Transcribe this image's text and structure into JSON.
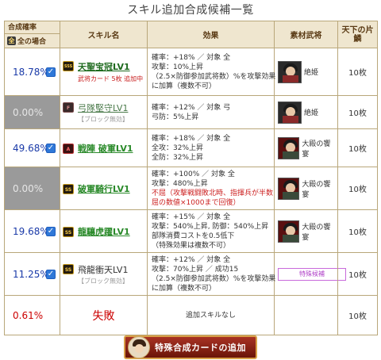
{
  "page_title": "スキル追加合成候補一覧",
  "headers": {
    "rate": "合成確率",
    "all_case": "全の場合",
    "all_icon": "全",
    "skill": "スキル名",
    "effect": "効果",
    "material": "素材武将",
    "tenka": "天下の片鱗"
  },
  "rows": [
    {
      "rate": "18.78%",
      "checked": true,
      "rank": "SSS",
      "skill_name": "天聖宝冠LV1",
      "sub": "武将カード 5枚 追加中",
      "effect_lines": [
        "確率：+18% ／ 対象 全",
        "攻撃：10%上昇",
        "（2.5×防御参加武将数）%を攻撃効果",
        "に加算（複数不可）"
      ],
      "material_name": "絶姫",
      "tenka": "10枚"
    },
    {
      "rate": "0.00%",
      "checked": false,
      "rank": "F",
      "skill_name": "弓隊堅守LV1",
      "blocked": "【ブロック無効】",
      "effect_lines": [
        "確率：+12% ／ 対象 弓",
        "弓防：5%上昇"
      ],
      "material_name": "絶姫",
      "tenka": "10枚"
    },
    {
      "rate": "49.68%",
      "checked": true,
      "rank": "A",
      "skill_name": "戦陣 破軍LV1",
      "effect_lines": [
        "確率：+18% ／ 対象 全",
        "全攻：32%上昇",
        "全防：32%上昇"
      ],
      "material_name": "大殿の饗宴",
      "tenka": "10枚"
    },
    {
      "rate": "0.00%",
      "checked": false,
      "rank": "SS",
      "skill_name": "破軍騎行LV1",
      "effect_lines": [
        "確率：+100% ／ 対象 全",
        "攻撃：480%上昇",
        "不屈（攻撃戦闘敗北時、指揮兵が半数",
        "屈の数値×1000まで回復）"
      ],
      "material_name": "大殿の饗宴",
      "tenka": "10枚"
    },
    {
      "rate": "19.68%",
      "checked": true,
      "rank": "SS",
      "skill_name": "龍驤虎躍LV1",
      "effect_lines": [
        "確率：+15% ／ 対象 全",
        "攻撃：540%上昇, 防御：540%上昇",
        "部隊消費コストを0.5低下",
        "（特殊効果は複数不可）"
      ],
      "material_name": "大殿の饗宴",
      "tenka": "10枚"
    },
    {
      "rate": "11.25%",
      "checked": true,
      "rank": "SS",
      "skill_name": "飛龍衝天LV1",
      "blocked": "【ブロック無効】",
      "effect_lines": [
        "確率：+12% ／ 対象 全",
        "攻撃：70%上昇 ／ 成功15",
        "（2.5×防御参加武将数）%を攻撃効果",
        "に加算（複数不可）"
      ],
      "material_special": "特殊候補",
      "tenka": "10枚"
    },
    {
      "rate": "0.61%",
      "fail": "失敗",
      "effect_center": "追加スキルなし",
      "tenka": "10枚"
    }
  ],
  "button_label": "特殊合成カードの追加",
  "colors": {
    "accent": "#a83224",
    "header_bg": "#efe6cf",
    "rate_blue": "#1a3aa8",
    "fail_red": "#cc0000"
  }
}
